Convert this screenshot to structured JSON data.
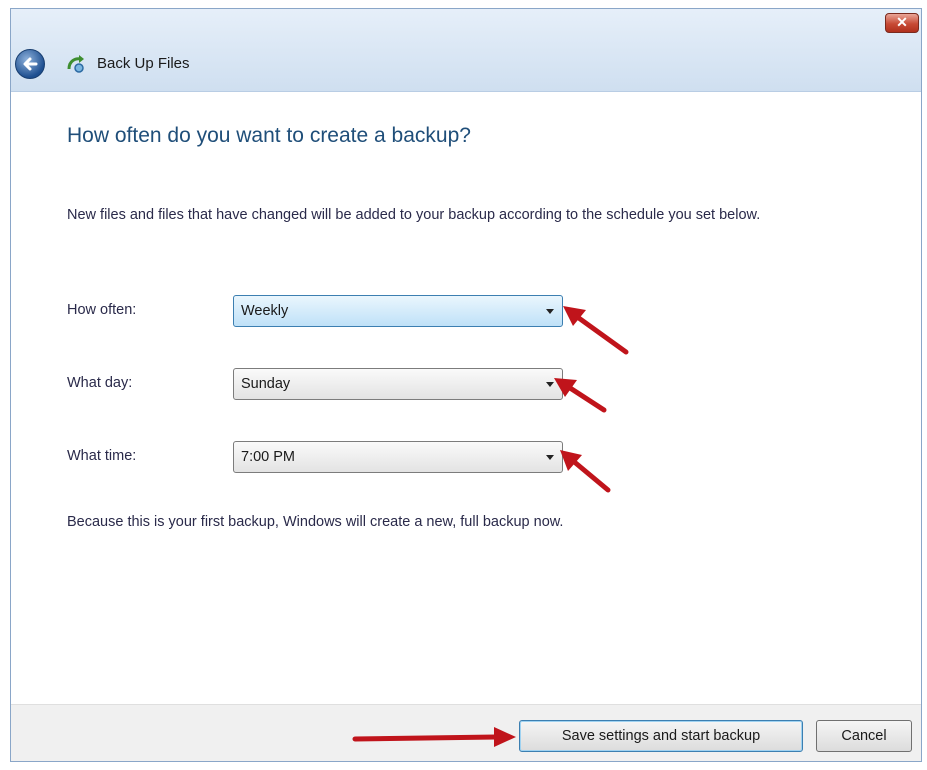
{
  "window": {
    "title": "Back Up Files",
    "close_label": "✕"
  },
  "page": {
    "heading": "How often do you want to create a backup?",
    "description": "New files and files that have changed will be added to your backup according to the schedule you set below.",
    "schedule": {
      "how_often": {
        "label": "How often:",
        "value": "Weekly"
      },
      "what_day": {
        "label": "What day:",
        "value": "Sunday"
      },
      "what_time": {
        "label": "What time:",
        "value": "7:00 PM"
      }
    },
    "note": "Because this is your first backup, Windows will create a new, full backup now."
  },
  "footer": {
    "save_label": "Save settings and start backup",
    "cancel_label": "Cancel"
  },
  "icons": {
    "back": "back-arrow-icon",
    "app": "backup-icon",
    "close": "close-icon",
    "dropdown": "chevron-down-icon",
    "annotation": "red-arrow"
  },
  "colors": {
    "heading": "#1f4e79",
    "annotation_arrow": "#c0141b",
    "active_combo": "#bfe1f8"
  }
}
